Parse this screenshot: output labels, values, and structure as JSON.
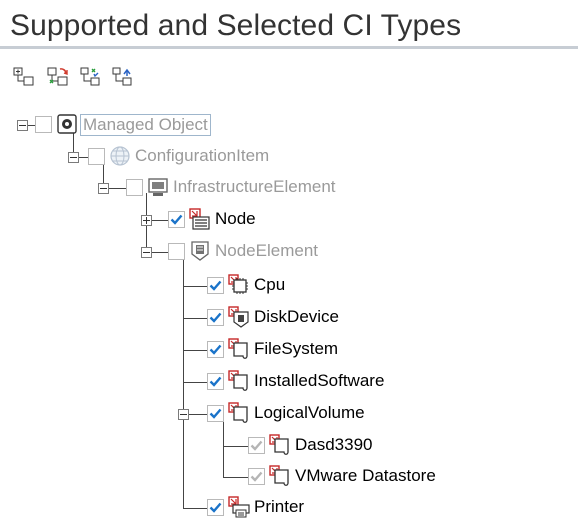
{
  "panel": {
    "title": "Supported and Selected CI Types"
  },
  "toolbar": {
    "buttons": [
      {
        "icon": "tree-expand-icon"
      },
      {
        "icon": "tree-refresh-icon"
      },
      {
        "icon": "tree-select-all-icon"
      },
      {
        "icon": "tree-deselect-all-icon"
      }
    ]
  },
  "tree": {
    "nodes": [
      {
        "label": "Managed Object",
        "checked": false,
        "icon": "managed-object-icon",
        "expanded": true
      },
      {
        "label": "ConfigurationItem",
        "checked": false,
        "icon": "configuration-item-icon",
        "expanded": true
      },
      {
        "label": "InfrastructureElement",
        "checked": false,
        "icon": "infrastructure-element-icon",
        "expanded": true
      },
      {
        "label": "Node",
        "checked": true,
        "icon": "node-icon",
        "expanded": false
      },
      {
        "label": "NodeElement",
        "checked": false,
        "icon": "node-element-icon",
        "expanded": true
      },
      {
        "label": "Cpu",
        "checked": true,
        "icon": "cpu-icon"
      },
      {
        "label": "DiskDevice",
        "checked": true,
        "icon": "disk-device-icon"
      },
      {
        "label": "FileSystem",
        "checked": true,
        "icon": "file-system-icon"
      },
      {
        "label": "InstalledSoftware",
        "checked": true,
        "icon": "installed-software-icon"
      },
      {
        "label": "LogicalVolume",
        "checked": true,
        "icon": "logical-volume-icon",
        "expanded": true
      },
      {
        "label": "Dasd3390",
        "checked": true,
        "disabled": true,
        "icon": "dasd-icon"
      },
      {
        "label": "VMware Datastore",
        "checked": true,
        "disabled": true,
        "icon": "vmware-datastore-icon"
      },
      {
        "label": "Printer",
        "checked": true,
        "icon": "printer-icon"
      }
    ]
  },
  "colors": {
    "check": "#1a73c9",
    "disabled_check": "#b5b5b5",
    "dim_text": "#9a9a9a",
    "icon_red": "#c62828"
  }
}
